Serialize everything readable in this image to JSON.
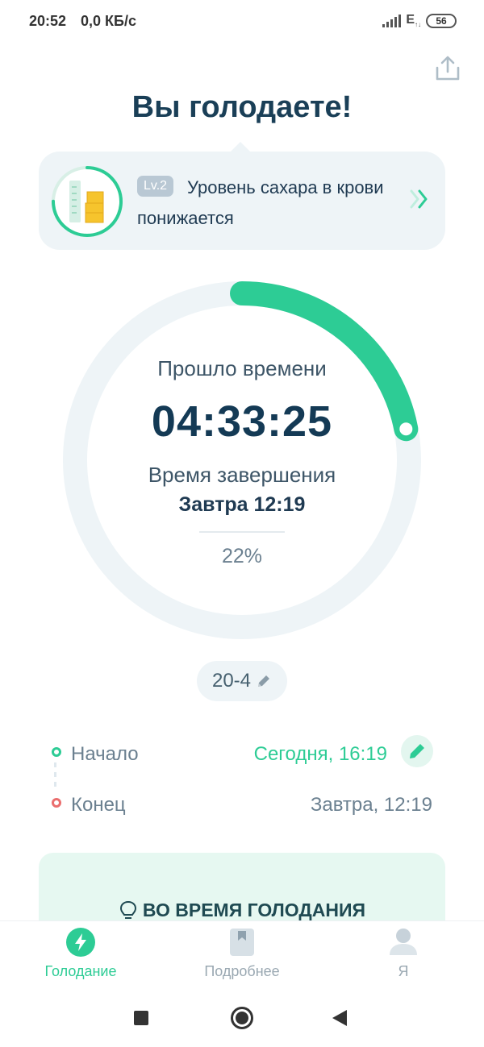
{
  "status_bar": {
    "time": "20:52",
    "speed": "0,0 КБ/с",
    "network": "E",
    "battery": "56"
  },
  "header": {
    "title": "Вы голодаете!",
    "share_icon": "share-icon"
  },
  "level_card": {
    "badge": "Lv.2",
    "text": "Уровень сахара в крови понижается",
    "icon": "blood-sugar-icon",
    "arrow_icon": "double-chevron-right-icon",
    "ring_progress": 0.75
  },
  "timer": {
    "elapsed_label": "Прошло времени",
    "elapsed_value": "04:33:25",
    "end_label": "Время завершения",
    "end_value": "Завтра 12:19",
    "percent": "22%",
    "progress": 0.22,
    "accent": "#2dcc95",
    "track": "#eef4f7"
  },
  "plan": {
    "label": "20-4",
    "icon": "pencil-icon"
  },
  "schedule": {
    "start_label": "Начало",
    "start_value": "Сегодня, 16:19",
    "end_label": "Конец",
    "end_value": "Завтра, 12:19"
  },
  "tips": {
    "title": "ВО ВРЕМЯ ГОЛОДАНИЯ",
    "icon": "lightbulb-icon"
  },
  "bottom_nav": {
    "items": [
      {
        "label": "Голодание",
        "icon": "lightning-icon",
        "active": true
      },
      {
        "label": "Подробнее",
        "icon": "bookmark-icon",
        "active": false
      },
      {
        "label": "Я",
        "icon": "user-icon",
        "active": false
      }
    ]
  },
  "system_nav": {
    "recents": "square-icon",
    "home": "home-circle-icon",
    "back": "back-triangle-icon"
  }
}
